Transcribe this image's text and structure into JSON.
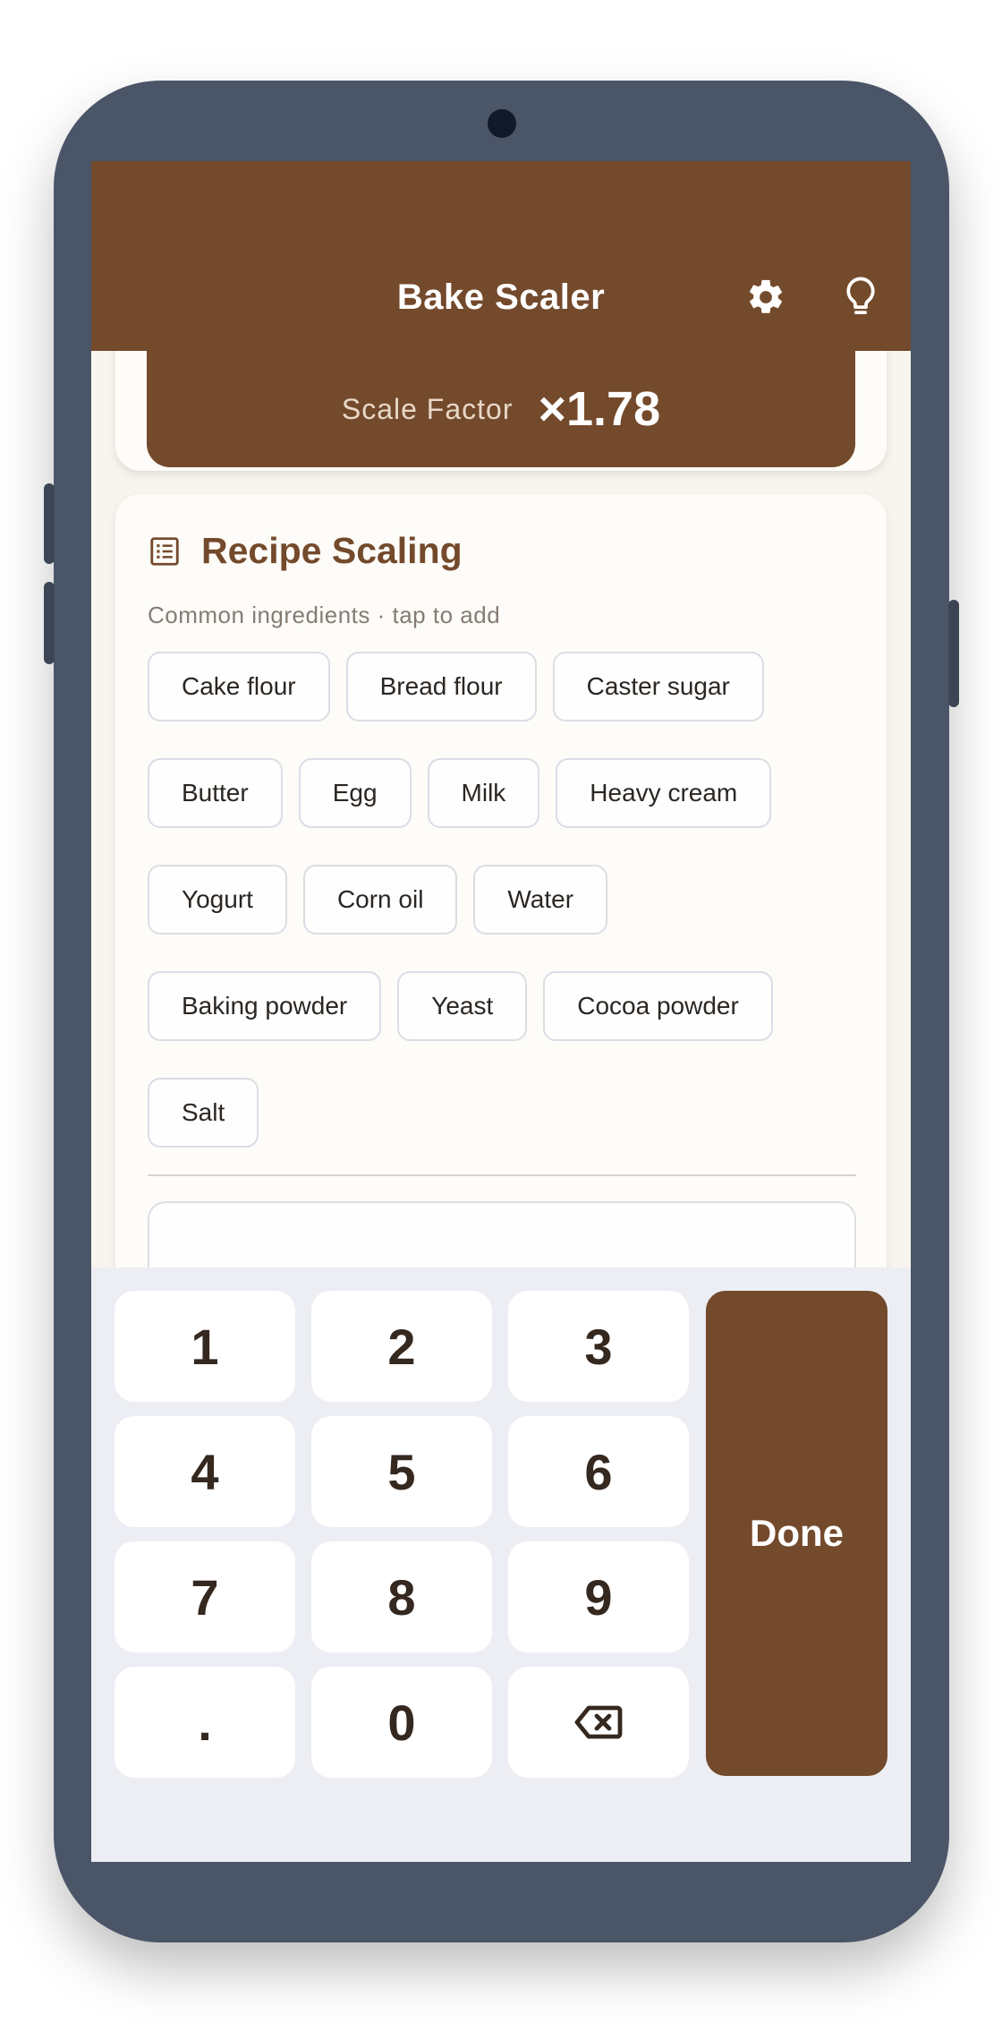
{
  "app": {
    "title": "Bake Scaler"
  },
  "scale": {
    "label": "Scale Factor",
    "value": "×1.78"
  },
  "recipe": {
    "title": "Recipe Scaling",
    "subtitle": "Common ingredients · tap to add",
    "ingredients": [
      [
        "Cake flour",
        "Bread flour",
        "Caster sugar"
      ],
      [
        "Butter",
        "Egg",
        "Milk",
        "Heavy cream"
      ],
      [
        "Yogurt",
        "Corn oil",
        "Water"
      ],
      [
        "Baking powder",
        "Yeast",
        "Cocoa powder"
      ],
      [
        "Salt"
      ]
    ]
  },
  "keypad": {
    "keys": [
      "1",
      "2",
      "3",
      "4",
      "5",
      "6",
      "7",
      "8",
      "9",
      ".",
      "0"
    ],
    "done_label": "Done"
  },
  "icons": {
    "settings": "gear-icon",
    "tips": "lightbulb-icon",
    "recipe": "list-icon",
    "backspace": "backspace-icon"
  },
  "colors": {
    "brand": "#744a2c",
    "background": "#f8f5ee",
    "keypad_bg": "#edeef4",
    "device_frame": "#4a5568"
  }
}
